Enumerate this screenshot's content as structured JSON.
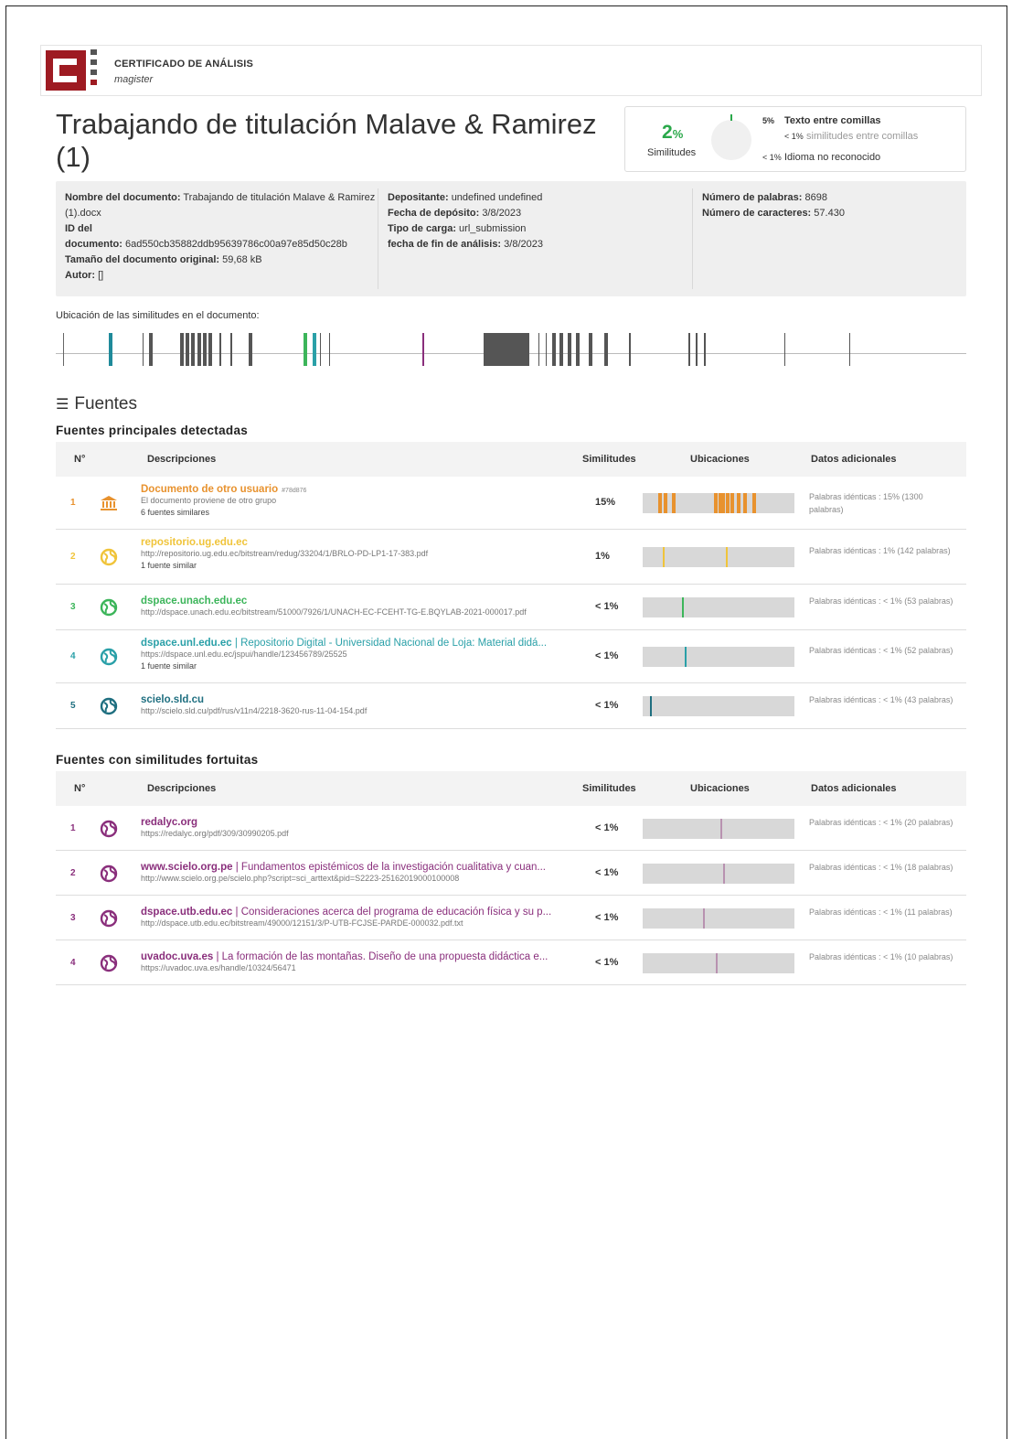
{
  "header": {
    "title": "CERTIFICADO DE ANÁLISIS",
    "subtitle": "magister"
  },
  "document_title": "Trabajando de titulación Malave & Ramirez (1)",
  "similarity": {
    "percent": "2",
    "percent_sign": "%",
    "label": "Similitudes",
    "quoted_pct": "5%",
    "quoted_label": "Texto entre comillas",
    "quoted_sim_pct": "< 1%",
    "quoted_sim_label": "similitudes entre comillas",
    "unrecognized_pct": "< 1%",
    "unrecognized_label": "Idioma no reconocido",
    "accent_color": "#2aa84a"
  },
  "info": {
    "doc_name_label": "Nombre del documento:",
    "doc_name_value": "Trabajando de titulación Malave & Ramirez (1).docx",
    "id_label_1": "ID del",
    "id_label_2": "documento:",
    "id_value": "6ad550cb35882ddb95639786c00a97e85d50c28b",
    "size_label": "Tamaño del documento original:",
    "size_value": "59,68 kB",
    "author_label": "Autor:",
    "author_value": "[]",
    "depositor_label": "Depositante:",
    "depositor_value": "undefined undefined",
    "deposit_date_label": "Fecha de depósito:",
    "deposit_date_value": "3/8/2023",
    "upload_type_label": "Tipo de carga:",
    "upload_type_value": "url_submission",
    "end_date_label": "fecha de fin de análisis:",
    "end_date_value": "3/8/2023",
    "words_label": "Número de palabras:",
    "words_value": "8698",
    "chars_label": "Número de caracteres:",
    "chars_value": "57.430"
  },
  "location_label": "Ubicación de las similitudes en el documento:",
  "sources_heading": "Fuentes",
  "main_sources_title": "Fuentes principales detectadas",
  "fortuitous_title": "Fuentes con similitudes fortuitas",
  "columns": {
    "num": "N°",
    "desc": "Descripciones",
    "sim": "Similitudes",
    "loc": "Ubicaciones",
    "extra": "Datos adicionales"
  },
  "main_sources": [
    {
      "num": "1",
      "icon": "institution-icon",
      "color": "#e8922e",
      "title": "Documento de otro usuario",
      "title_rest": "",
      "tag": "#78d876",
      "url": "El documento proviene de otro grupo",
      "sub": "6 fuentes similares",
      "sim": "15%",
      "extra": "Palabras idénticas : 15% (1300 palabras)",
      "marks": [
        0.1,
        0.14,
        0.19,
        0.47,
        0.5,
        0.52,
        0.55,
        0.58,
        0.62,
        0.66,
        0.72
      ],
      "mark_color": "#e8922e"
    },
    {
      "num": "2",
      "icon": "globe-icon",
      "color": "#f0c43a",
      "title": "repositorio.ug.edu.ec",
      "title_rest": "",
      "tag": "",
      "url": "http://repositorio.ug.edu.ec/bitstream/redug/33204/1/BRLO-PD-LP1-17-383.pdf",
      "sub": "1 fuente similar",
      "sim": "1%",
      "extra": "Palabras idénticas : 1% (142 palabras)",
      "marks": [
        0.13,
        0.55
      ],
      "mark_color": "#f0c43a"
    },
    {
      "num": "3",
      "icon": "globe-icon",
      "color": "#3cb55a",
      "title": "dspace.unach.edu.ec",
      "title_rest": "",
      "tag": "",
      "url": "http://dspace.unach.edu.ec/bitstream/51000/7926/1/UNACH-EC-FCEHT-TG-E.BQYLAB-2021-000017.pdf",
      "sub": "",
      "sim": "< 1%",
      "extra": "Palabras idénticas : < 1% (53 palabras)",
      "marks": [
        0.26
      ],
      "mark_color": "#3cb55a"
    },
    {
      "num": "4",
      "icon": "globe-icon",
      "color": "#2aa0a8",
      "title": "dspace.unl.edu.ec",
      "title_rest": " | Repositorio Digital - Universidad Nacional de Loja: Material didá...",
      "tag": "",
      "url": "https://dspace.unl.edu.ec/jspui/handle/123456789/25525",
      "sub": "1 fuente similar",
      "sim": "< 1%",
      "extra": "Palabras idénticas : < 1% (52 palabras)",
      "marks": [
        0.28
      ],
      "mark_color": "#2aa0a8"
    },
    {
      "num": "5",
      "icon": "globe-icon",
      "color": "#1f6f80",
      "title": "scielo.sld.cu",
      "title_rest": "",
      "tag": "",
      "url": "http://scielo.sld.cu/pdf/rus/v11n4/2218-3620-rus-11-04-154.pdf",
      "sub": "",
      "sim": "< 1%",
      "extra": "Palabras idénticas : < 1% (43 palabras)",
      "marks": [
        0.05
      ],
      "mark_color": "#1f6f80"
    }
  ],
  "fortuitous_sources": [
    {
      "num": "1",
      "icon": "globe-icon",
      "color": "#8a2f7c",
      "title": "redalyc.org",
      "title_rest": "",
      "url": "https://redalyc.org/pdf/309/30990205.pdf",
      "sim": "< 1%",
      "extra": "Palabras idénticas : < 1% (20 palabras)",
      "marks": [
        0.51
      ],
      "mark_color": "#b892b0"
    },
    {
      "num": "2",
      "icon": "globe-icon",
      "color": "#8a2f7c",
      "title": "www.scielo.org.pe",
      "title_rest": " | Fundamentos epistémicos de la investigación cualitativa y cuan...",
      "url": "http://www.scielo.org.pe/scielo.php?script=sci_arttext&pid=S2223-25162019000100008",
      "sim": "< 1%",
      "extra": "Palabras idénticas : < 1% (18 palabras)",
      "marks": [
        0.53
      ],
      "mark_color": "#b892b0"
    },
    {
      "num": "3",
      "icon": "globe-icon",
      "color": "#8a2f7c",
      "title": "dspace.utb.edu.ec",
      "title_rest": " | Consideraciones acerca del programa de educación física y su p...",
      "url": "http://dspace.utb.edu.ec/bitstream/49000/12151/3/P-UTB-FCJSE-PARDE-000032.pdf.txt",
      "sim": "< 1%",
      "extra": "Palabras idénticas : < 1% (11 palabras)",
      "marks": [
        0.4
      ],
      "mark_color": "#b892b0"
    },
    {
      "num": "4",
      "icon": "globe-icon",
      "color": "#8a2f7c",
      "title": "uvadoc.uva.es",
      "title_rest": " | La formación de las montañas. Diseño de una propuesta didáctica e...",
      "url": "https://uvadoc.uva.es/handle/10324/56471",
      "sim": "< 1%",
      "extra": "Palabras idénticas : < 1% (10 palabras)",
      "marks": [
        0.48
      ],
      "mark_color": "#b892b0"
    }
  ],
  "location_marks": [
    {
      "at": 0.008,
      "color": "#666",
      "weight": "thin"
    },
    {
      "at": 0.058,
      "color": "#1f8a9a",
      "weight": "bold"
    },
    {
      "at": 0.095,
      "color": "#555",
      "weight": "thin"
    },
    {
      "at": 0.102,
      "color": "#555",
      "weight": "bold"
    },
    {
      "at": 0.137,
      "color": "#555",
      "weight": "bold"
    },
    {
      "at": 0.143,
      "color": "#555",
      "weight": "bold"
    },
    {
      "at": 0.149,
      "color": "#555",
      "weight": "bold"
    },
    {
      "at": 0.156,
      "color": "#555",
      "weight": "bold"
    },
    {
      "at": 0.162,
      "color": "#555",
      "weight": "bold"
    },
    {
      "at": 0.168,
      "color": "#555",
      "weight": "bold"
    },
    {
      "at": 0.18,
      "color": "#555",
      "weight": "thin"
    },
    {
      "at": 0.192,
      "color": "#555",
      "weight": "thin"
    },
    {
      "at": 0.212,
      "color": "#555",
      "weight": "bold"
    },
    {
      "at": 0.272,
      "color": "#3cb55a",
      "weight": "bold"
    },
    {
      "at": 0.282,
      "color": "#2aa0a8",
      "weight": "bold"
    },
    {
      "at": 0.29,
      "color": "#555",
      "weight": "thin"
    },
    {
      "at": 0.3,
      "color": "#555",
      "weight": "thin"
    },
    {
      "at": 0.403,
      "color": "#8a2f7c",
      "weight": "thin"
    },
    {
      "at": 0.47,
      "color": "#555",
      "weight": "block4"
    },
    {
      "at": 0.53,
      "color": "#555",
      "weight": "thin"
    },
    {
      "at": 0.538,
      "color": "#555",
      "weight": "thin"
    },
    {
      "at": 0.545,
      "color": "#555",
      "weight": "bold"
    },
    {
      "at": 0.553,
      "color": "#555",
      "weight": "bold"
    },
    {
      "at": 0.562,
      "color": "#555",
      "weight": "bold"
    },
    {
      "at": 0.571,
      "color": "#555",
      "weight": "bold"
    },
    {
      "at": 0.585,
      "color": "#555",
      "weight": "bold"
    },
    {
      "at": 0.602,
      "color": "#555",
      "weight": "bold"
    },
    {
      "at": 0.63,
      "color": "#555",
      "weight": "thin"
    },
    {
      "at": 0.695,
      "color": "#555",
      "weight": "thin"
    },
    {
      "at": 0.703,
      "color": "#555",
      "weight": "thin"
    },
    {
      "at": 0.712,
      "color": "#555",
      "weight": "thin"
    },
    {
      "at": 0.8,
      "color": "#555",
      "weight": "thin"
    },
    {
      "at": 0.871,
      "color": "#555",
      "weight": "thin"
    }
  ]
}
